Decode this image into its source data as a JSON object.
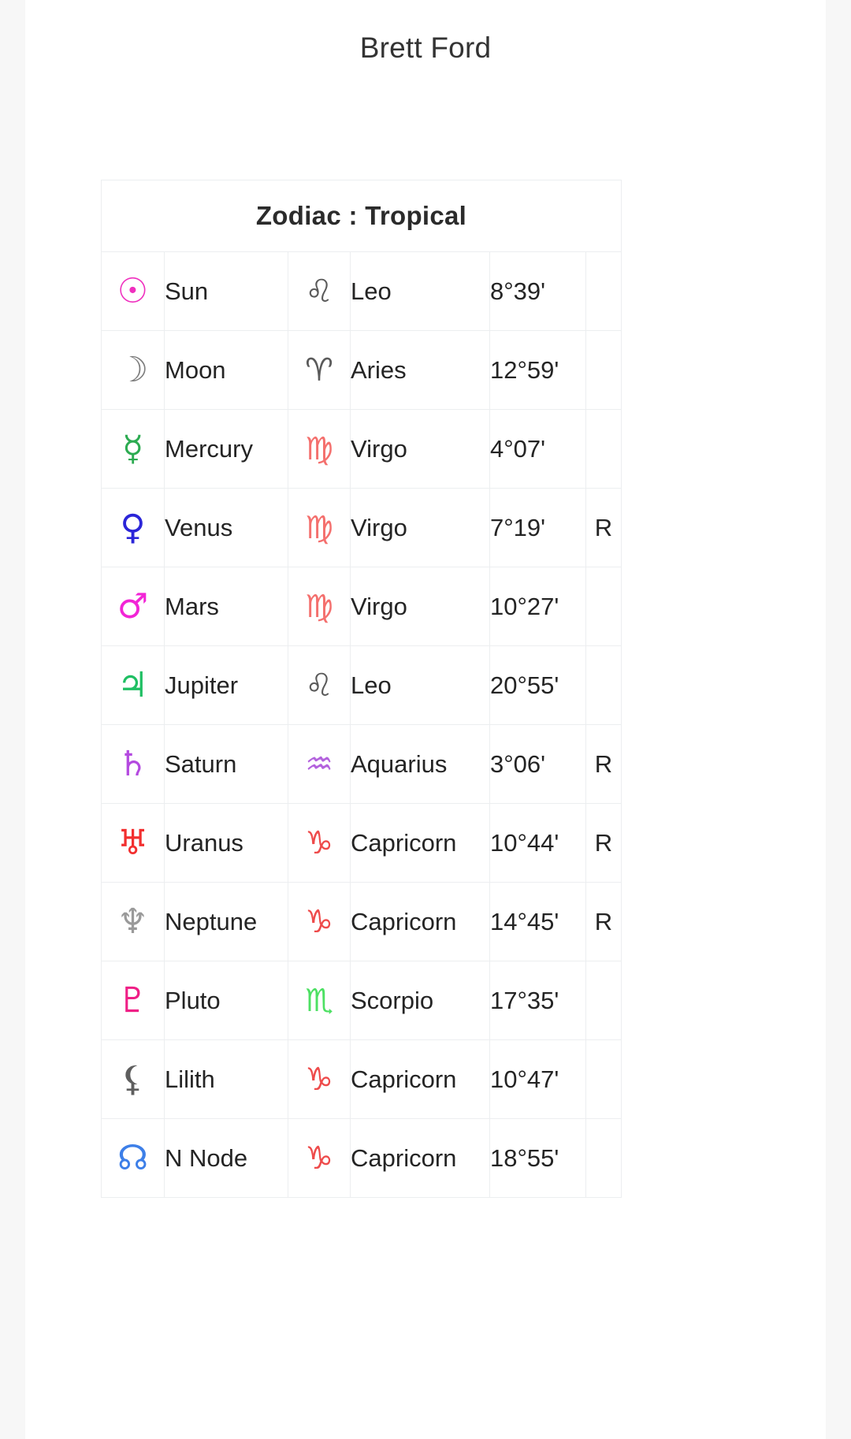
{
  "person": {
    "name": "Brett Ford"
  },
  "table": {
    "title": "Zodiac : Tropical",
    "rows": [
      {
        "planet_glyph": "☉",
        "planet_color": "#ef2fbe",
        "planet": "Sun",
        "sign_glyph": "♌",
        "sign_color": "#5a5a5a",
        "sign": "Leo",
        "degree": "8°39'",
        "retrograde": ""
      },
      {
        "planet_glyph": "☽",
        "planet_color": "#7d7d7d",
        "planet": "Moon",
        "sign_glyph": "♈",
        "sign_color": "#5a5a5a",
        "sign": "Aries",
        "degree": "12°59'",
        "retrograde": ""
      },
      {
        "planet_glyph": "☿",
        "planet_color": "#2cab51",
        "planet": "Mercury",
        "sign_glyph": "♍",
        "sign_color": "#f4706e",
        "sign": "Virgo",
        "degree": "4°07'",
        "retrograde": ""
      },
      {
        "planet_glyph": "♀",
        "planet_color": "#2b25d8",
        "planet": "Venus",
        "sign_glyph": "♍",
        "sign_color": "#f4706e",
        "sign": "Virgo",
        "degree": "7°19'",
        "retrograde": "R"
      },
      {
        "planet_glyph": "♂",
        "planet_color": "#f224d6",
        "planet": "Mars",
        "sign_glyph": "♍",
        "sign_color": "#f4706e",
        "sign": "Virgo",
        "degree": "10°27'",
        "retrograde": ""
      },
      {
        "planet_glyph": "♃",
        "planet_color": "#1fbf63",
        "planet": "Jupiter",
        "sign_glyph": "♌",
        "sign_color": "#5a5a5a",
        "sign": "Leo",
        "degree": "20°55'",
        "retrograde": ""
      },
      {
        "planet_glyph": "♄",
        "planet_color": "#b44ae0",
        "planet": "Saturn",
        "sign_glyph": "♒",
        "sign_color": "#b362dd",
        "sign": "Aquarius",
        "degree": "3°06'",
        "retrograde": "R"
      },
      {
        "planet_glyph": "♅",
        "planet_color": "#f22f2f",
        "planet": "Uranus",
        "sign_glyph": "♑",
        "sign_color": "#ee4b4b",
        "sign": "Capricorn",
        "degree": "10°44'",
        "retrograde": "R"
      },
      {
        "planet_glyph": "♆",
        "planet_color": "#9a9a9a",
        "planet": "Neptune",
        "sign_glyph": "♑",
        "sign_color": "#ee4b4b",
        "sign": "Capricorn",
        "degree": "14°45'",
        "retrograde": "R"
      },
      {
        "planet_glyph": "♇",
        "planet_color": "#ef1f86",
        "planet": "Pluto",
        "sign_glyph": "♏",
        "sign_color": "#4de063",
        "sign": "Scorpio",
        "degree": "17°35'",
        "retrograde": ""
      },
      {
        "planet_glyph": "⚸",
        "planet_color": "#5e5e5e",
        "planet": "Lilith",
        "sign_glyph": "♑",
        "sign_color": "#ee4b4b",
        "sign": "Capricorn",
        "degree": "10°47'",
        "retrograde": ""
      },
      {
        "planet_glyph": "☊",
        "planet_color": "#3d7fe8",
        "planet": "N Node",
        "sign_glyph": "♑",
        "sign_color": "#ee4b4b",
        "sign": "Capricorn",
        "degree": "18°55'",
        "retrograde": ""
      }
    ]
  },
  "colors": {
    "page_background": "#f7f7f7",
    "card_background": "#ffffff",
    "grid_line": "#eceef0",
    "text": "#242424"
  }
}
